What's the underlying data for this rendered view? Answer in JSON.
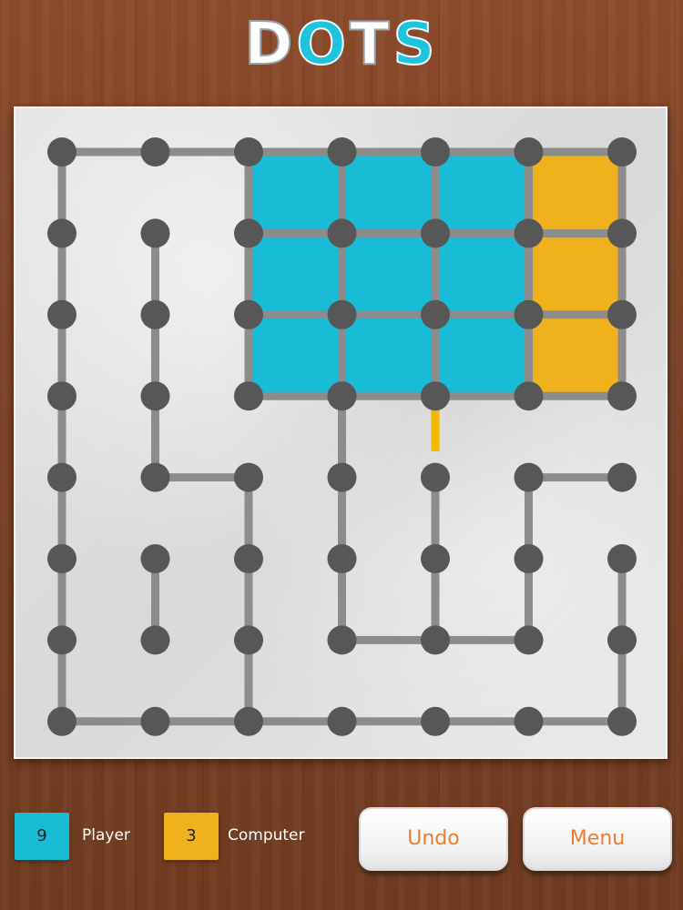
{
  "title": {
    "letters": [
      "D",
      "O",
      "T",
      "S"
    ]
  },
  "colors": {
    "player": "#19bcd6",
    "computer": "#f0b21c",
    "line": "#8c8c8c",
    "last_move": "#f5b800",
    "dot": "#575757"
  },
  "board": {
    "cols": 7,
    "rows": 8,
    "h_lines": [
      [
        0,
        0
      ],
      [
        1,
        0
      ],
      [
        2,
        0
      ],
      [
        3,
        0
      ],
      [
        4,
        0
      ],
      [
        5,
        0
      ],
      [
        2,
        1
      ],
      [
        3,
        1
      ],
      [
        4,
        1
      ],
      [
        5,
        1
      ],
      [
        2,
        2
      ],
      [
        3,
        2
      ],
      [
        4,
        2
      ],
      [
        5,
        2
      ],
      [
        2,
        3
      ],
      [
        3,
        3
      ],
      [
        4,
        3
      ],
      [
        5,
        3
      ],
      [
        1,
        4
      ],
      [
        5,
        4
      ],
      [
        3,
        6
      ],
      [
        4,
        6
      ],
      [
        0,
        7
      ],
      [
        1,
        7
      ],
      [
        2,
        7
      ],
      [
        3,
        7
      ],
      [
        4,
        7
      ],
      [
        5,
        7
      ]
    ],
    "v_lines": [
      [
        0,
        0
      ],
      [
        0,
        1
      ],
      [
        0,
        2
      ],
      [
        0,
        3
      ],
      [
        0,
        4
      ],
      [
        0,
        5
      ],
      [
        0,
        6
      ],
      [
        1,
        1
      ],
      [
        1,
        2
      ],
      [
        1,
        3
      ],
      [
        1,
        5
      ],
      [
        2,
        0
      ],
      [
        2,
        1
      ],
      [
        2,
        2
      ],
      [
        2,
        4
      ],
      [
        2,
        5
      ],
      [
        2,
        6
      ],
      [
        3,
        0
      ],
      [
        3,
        1
      ],
      [
        3,
        2
      ],
      [
        3,
        3
      ],
      [
        3,
        4
      ],
      [
        3,
        5
      ],
      [
        4,
        0
      ],
      [
        4,
        1
      ],
      [
        4,
        2
      ],
      [
        4,
        4
      ],
      [
        4,
        5
      ],
      [
        5,
        0
      ],
      [
        5,
        1
      ],
      [
        5,
        2
      ],
      [
        5,
        4
      ],
      [
        5,
        5
      ],
      [
        6,
        0
      ],
      [
        6,
        1
      ],
      [
        6,
        2
      ],
      [
        6,
        5
      ],
      [
        6,
        6
      ]
    ],
    "last_move": {
      "orientation": "v",
      "col": 4,
      "row": 3
    },
    "boxes": [
      {
        "col": 2,
        "row": 0,
        "owner": "player"
      },
      {
        "col": 3,
        "row": 0,
        "owner": "player"
      },
      {
        "col": 4,
        "row": 0,
        "owner": "player"
      },
      {
        "col": 5,
        "row": 0,
        "owner": "computer"
      },
      {
        "col": 2,
        "row": 1,
        "owner": "player"
      },
      {
        "col": 3,
        "row": 1,
        "owner": "player"
      },
      {
        "col": 4,
        "row": 1,
        "owner": "player"
      },
      {
        "col": 5,
        "row": 1,
        "owner": "computer"
      },
      {
        "col": 2,
        "row": 2,
        "owner": "player"
      },
      {
        "col": 3,
        "row": 2,
        "owner": "player"
      },
      {
        "col": 4,
        "row": 2,
        "owner": "player"
      },
      {
        "col": 5,
        "row": 2,
        "owner": "computer"
      }
    ]
  },
  "scores": {
    "player": {
      "value": "9",
      "label": "Player"
    },
    "computer": {
      "value": "3",
      "label": "Computer"
    }
  },
  "buttons": {
    "undo": "Undo",
    "menu": "Menu"
  }
}
